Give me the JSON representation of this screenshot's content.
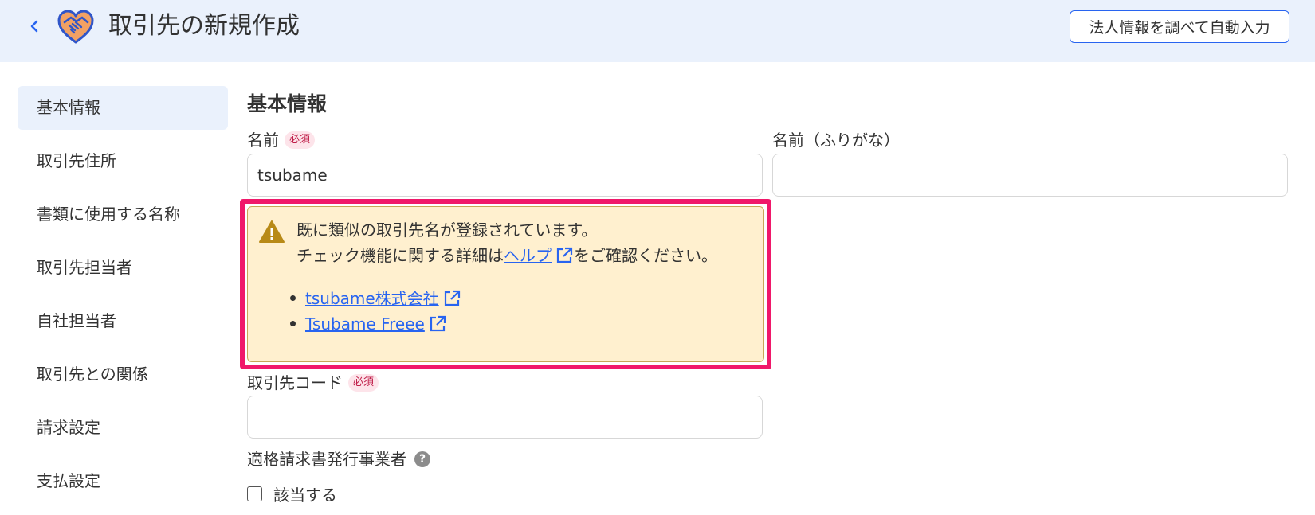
{
  "header": {
    "title": "取引先の新規作成",
    "autofill_label": "法人情報を調べて自動入力"
  },
  "sidebar": {
    "items": [
      {
        "label": "基本情報",
        "active": true
      },
      {
        "label": "取引先住所"
      },
      {
        "label": "書類に使用する名称"
      },
      {
        "label": "取引先担当者"
      },
      {
        "label": "自社担当者"
      },
      {
        "label": "取引先との関係"
      },
      {
        "label": "請求設定"
      },
      {
        "label": "支払設定"
      }
    ]
  },
  "main": {
    "section_title": "基本情報",
    "required_label": "必須",
    "name": {
      "label": "名前",
      "value": "tsubame"
    },
    "name_kana": {
      "label": "名前（ふりがな）",
      "value": ""
    },
    "alert": {
      "line1": "既に類似の取引先名が登録されています。",
      "line2_prefix": "チェック機能に関する詳細は",
      "help_link": "ヘルプ",
      "line2_suffix": "をご確認ください。",
      "similar": [
        "tsubame株式会社",
        "Tsubame Freee"
      ]
    },
    "partner_code": {
      "label": "取引先コード",
      "value": ""
    },
    "invoice_issuer": {
      "label": "適格請求書発行事業者",
      "help_glyph": "?",
      "checkbox_label": "該当する",
      "checked": false
    }
  },
  "colors": {
    "header_bg": "#eaf1fc",
    "accent": "#2864f0",
    "highlight": "#f0186a",
    "warning_bg": "#fff0cf",
    "warning_icon": "#b88a17",
    "required_text": "#c01f4a",
    "required_bg": "#fde4ea"
  },
  "icons": {
    "back": "chevron-left-icon",
    "logo": "handshake-heart-icon",
    "warning": "warning-triangle-icon",
    "external": "external-link-icon",
    "help": "question-circle-icon"
  }
}
